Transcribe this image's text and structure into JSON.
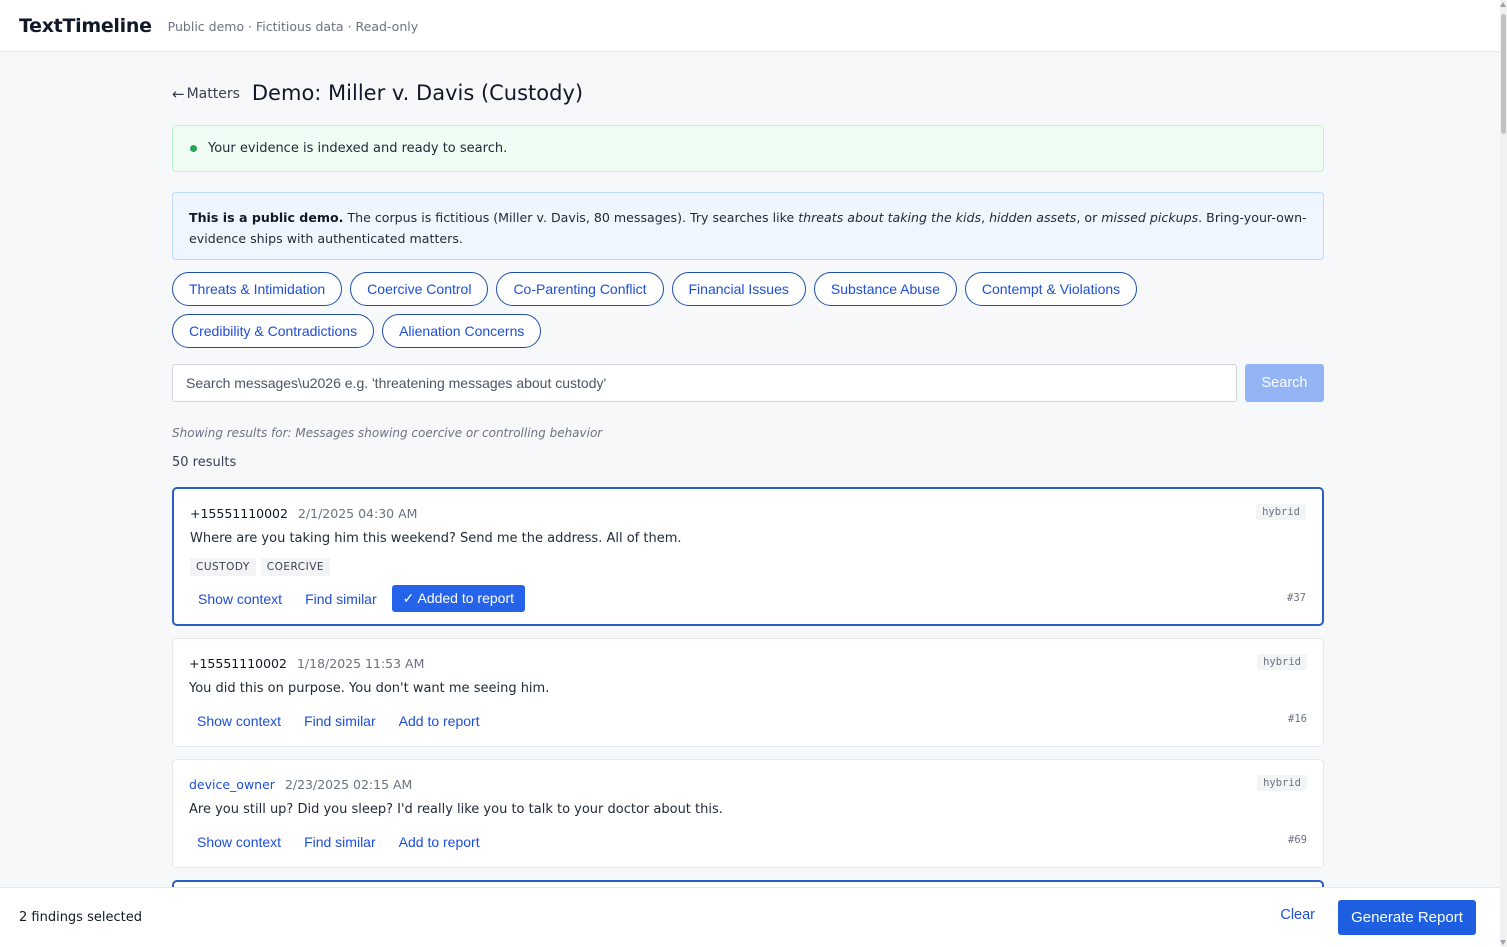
{
  "header": {
    "brand": "TextTimeline",
    "subtitle": "Public demo · Fictitious data · Read-only"
  },
  "title_row": {
    "back_label": "Matters",
    "back_arrow": "←",
    "title": "Demo: Miller v. Davis (Custody)"
  },
  "status": {
    "text": "Your evidence is indexed and ready to search.",
    "color": "#22a55a"
  },
  "info": {
    "bold": "This is a public demo.",
    "text1": " The corpus is fictitious (Miller v. Davis, 80 messages). Try searches like ",
    "ex1": "threats about taking the kids",
    "sep1": ", ",
    "ex2": "hidden assets",
    "sep2": ", or ",
    "ex3": "missed pickups",
    "text2": ". Bring-your-own-evidence ships with authenticated matters."
  },
  "chips": [
    "Threats & Intimidation",
    "Coercive Control",
    "Co-Parenting Conflict",
    "Financial Issues",
    "Substance Abuse",
    "Contempt & Violations",
    "Credibility & Contradictions",
    "Alienation Concerns"
  ],
  "search": {
    "placeholder": "Search messages\\u2026 e.g. 'threatening messages about custody'",
    "button": "Search"
  },
  "showing": "Showing results for: Messages showing coercive or controlling behavior",
  "count": "50 results",
  "results": [
    {
      "sender": "+15551110002",
      "time": "2/1/2025 04:30 AM",
      "badge": "hybrid",
      "message": "Where are you taking him this weekend? Send me the address. All of them.",
      "tags": [
        "CUSTODY",
        "COERCIVE"
      ],
      "show_context": "Show context",
      "find_similar": "Find similar",
      "report_label": "✓ Added to report",
      "id": "#37"
    },
    {
      "sender": "+15551110002",
      "time": "1/18/2025 11:53 AM",
      "badge": "hybrid",
      "message": "You did this on purpose. You don't want me seeing him.",
      "show_context": "Show context",
      "find_similar": "Find similar",
      "report_label": "Add to report",
      "id": "#16"
    },
    {
      "sender": "device_owner",
      "time": "2/23/2025 02:15 AM",
      "badge": "hybrid",
      "message": "Are you still up? Did you sleep? I'd really like you to talk to your doctor about this.",
      "show_context": "Show context",
      "find_similar": "Find similar",
      "report_label": "Add to report",
      "id": "#69"
    }
  ],
  "footer": {
    "findings": "2 findings selected",
    "clear": "Clear",
    "generate": "Generate Report"
  }
}
